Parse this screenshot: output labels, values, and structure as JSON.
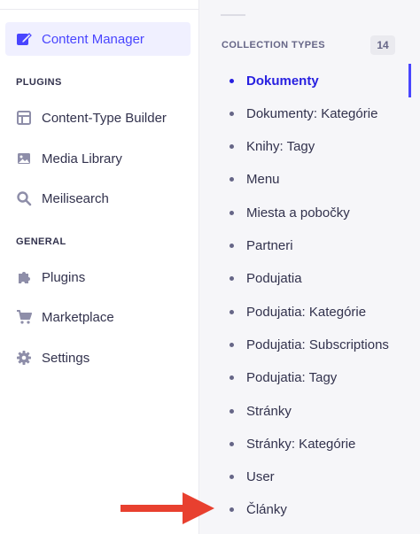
{
  "sidebar": {
    "content_manager": "Content Manager",
    "plugins_title": "PLUGINS",
    "plugins": [
      {
        "label": "Content-Type Builder",
        "icon": "layout-icon"
      },
      {
        "label": "Media Library",
        "icon": "image-icon"
      },
      {
        "label": "Meilisearch",
        "icon": "search-icon"
      }
    ],
    "general_title": "GENERAL",
    "general": [
      {
        "label": "Plugins",
        "icon": "puzzle-icon"
      },
      {
        "label": "Marketplace",
        "icon": "cart-icon"
      },
      {
        "label": "Settings",
        "icon": "gear-icon"
      }
    ]
  },
  "collections": {
    "title": "COLLECTION TYPES",
    "count": "14",
    "items": [
      "Dokumenty",
      "Dokumenty: Kategórie",
      "Knihy: Tagy",
      "Menu",
      "Miesta a pobočky",
      "Partneri",
      "Podujatia",
      "Podujatia: Kategórie",
      "Podujatia: Subscriptions",
      "Podujatia: Tagy",
      "Stránky",
      "Stránky: Kategórie",
      "User",
      "Články"
    ],
    "active_index": 0
  },
  "colors": {
    "accent": "#4945ff",
    "active_text": "#271fe0",
    "arrow": "#e8402f"
  }
}
